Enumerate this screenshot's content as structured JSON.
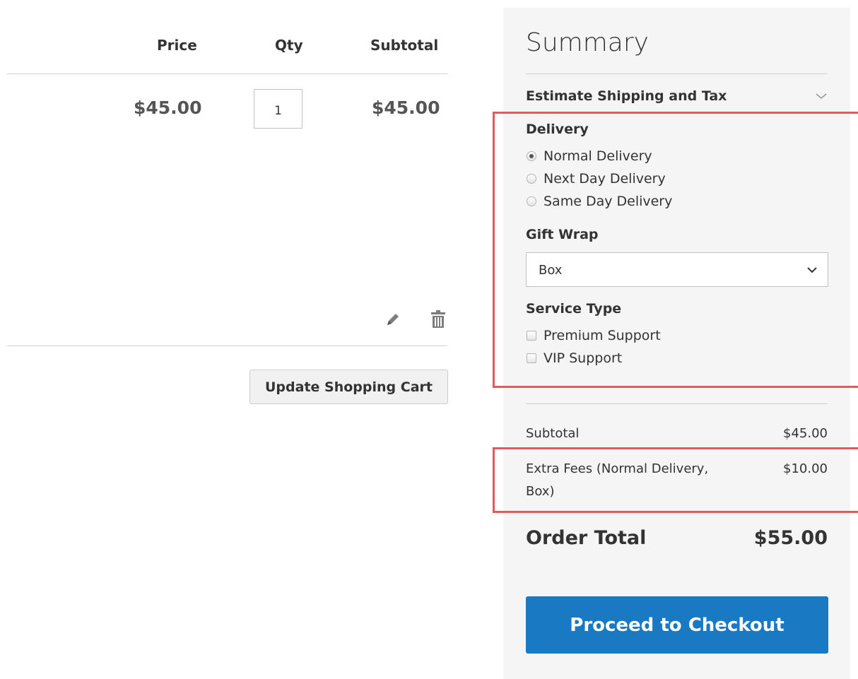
{
  "cart": {
    "headers": {
      "price": "Price",
      "qty": "Qty",
      "subtotal": "Subtotal"
    },
    "item": {
      "price": "$45.00",
      "qty": "1",
      "subtotal": "$45.00"
    },
    "actions": {
      "edit_icon": "pencil-icon",
      "delete_icon": "trash-icon"
    },
    "update_label": "Update Shopping Cart"
  },
  "summary": {
    "title": "Summary",
    "estimate_label": "Estimate Shipping and Tax",
    "delivery": {
      "title": "Delivery",
      "options": [
        "Normal Delivery",
        "Next Day Delivery",
        "Same Day Delivery"
      ],
      "selected": "Normal Delivery"
    },
    "gift_wrap": {
      "title": "Gift Wrap",
      "selected": "Box"
    },
    "service_type": {
      "title": "Service Type",
      "options": [
        "Premium Support",
        "VIP Support"
      ]
    },
    "subtotal_label": "Subtotal",
    "subtotal_value": "$45.00",
    "extra_fees_label": "Extra Fees (Normal Delivery, Box)",
    "extra_fees_value": "$10.00",
    "order_total_label": "Order Total",
    "order_total_value": "$55.00",
    "checkout_label": "Proceed to Checkout"
  },
  "colors": {
    "primary_button": "#1979c3",
    "highlight_border": "#e05a5f",
    "panel_bg": "#f5f5f5"
  }
}
